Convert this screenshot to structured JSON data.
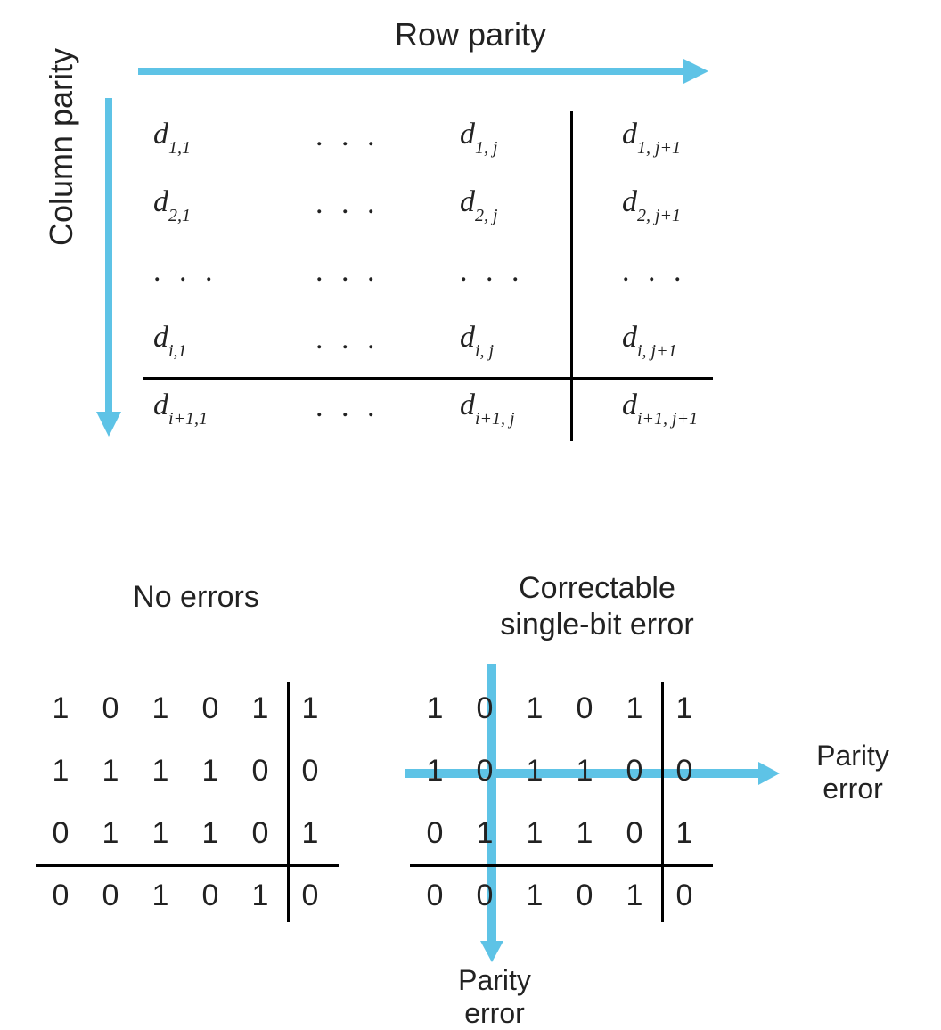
{
  "top": {
    "row_parity_label": "Row parity",
    "column_parity_label": "Column parity",
    "symbolic_grid": {
      "rows": [
        [
          {
            "base": "d",
            "sub": "1,1"
          },
          {
            "dots": ". . ."
          },
          {
            "base": "d",
            "sub": "1, j"
          },
          {
            "base": "d",
            "sub": "1, j+1"
          }
        ],
        [
          {
            "base": "d",
            "sub": "2,1"
          },
          {
            "dots": ". . ."
          },
          {
            "base": "d",
            "sub": "2, j"
          },
          {
            "base": "d",
            "sub": "2, j+1"
          }
        ],
        [
          {
            "dots": ". . ."
          },
          {
            "dots": ". . ."
          },
          {
            "dots": ". . ."
          },
          {
            "dots": ". . ."
          }
        ],
        [
          {
            "base": "d",
            "sub": "i,1"
          },
          {
            "dots": ". . ."
          },
          {
            "base": "d",
            "sub": "i, j"
          },
          {
            "base": "d",
            "sub": "i, j+1"
          }
        ],
        [
          {
            "base": "d",
            "sub": "i+1,1"
          },
          {
            "dots": ". . ."
          },
          {
            "base": "d",
            "sub": "i+1, j"
          },
          {
            "base": "d",
            "sub": "i+1, j+1"
          }
        ]
      ]
    }
  },
  "examples": {
    "no_errors": {
      "title": "No errors",
      "data_rows": [
        [
          1,
          0,
          1,
          0,
          1
        ],
        [
          1,
          1,
          1,
          1,
          0
        ],
        [
          0,
          1,
          1,
          1,
          0
        ]
      ],
      "row_parity": [
        1,
        0,
        1
      ],
      "col_parity": [
        0,
        0,
        1,
        0,
        1
      ],
      "overall_parity": 0
    },
    "correctable": {
      "title": "Correctable\nsingle-bit error",
      "data_rows": [
        [
          1,
          0,
          1,
          0,
          1
        ],
        [
          1,
          0,
          1,
          1,
          0
        ],
        [
          0,
          1,
          1,
          1,
          0
        ]
      ],
      "row_parity": [
        1,
        0,
        1
      ],
      "col_parity": [
        0,
        0,
        1,
        0,
        1
      ],
      "overall_parity": 0,
      "error_row_index": 1,
      "error_col_index": 1,
      "parity_error_label": "Parity\nerror"
    }
  },
  "chart_data": {
    "type": "table",
    "description": "Two-dimensional parity scheme. Upper grid shows symbolic layout of data bits d_{i,j} with an extra row-parity column (j+1) and column-parity row (i+1). Blue arrows indicate direction of row parity (rightward) and column parity (downward). Lower two 4x6 bit matrices show a concrete example: left matrix has no parity errors; right matrix has a single flipped bit at row 2, column 2, and blue crosshair arrows mark the row- and column-parity mismatches that localize the error.",
    "no_errors_matrix": [
      [
        1,
        0,
        1,
        0,
        1,
        1
      ],
      [
        1,
        1,
        1,
        1,
        0,
        0
      ],
      [
        0,
        1,
        1,
        1,
        0,
        1
      ],
      [
        0,
        0,
        1,
        0,
        1,
        0
      ]
    ],
    "correctable_error_matrix": [
      [
        1,
        0,
        1,
        0,
        1,
        1
      ],
      [
        1,
        0,
        1,
        1,
        0,
        0
      ],
      [
        0,
        1,
        1,
        1,
        0,
        1
      ],
      [
        0,
        0,
        1,
        0,
        1,
        0
      ]
    ],
    "error_location": {
      "row": 1,
      "col": 1
    }
  }
}
